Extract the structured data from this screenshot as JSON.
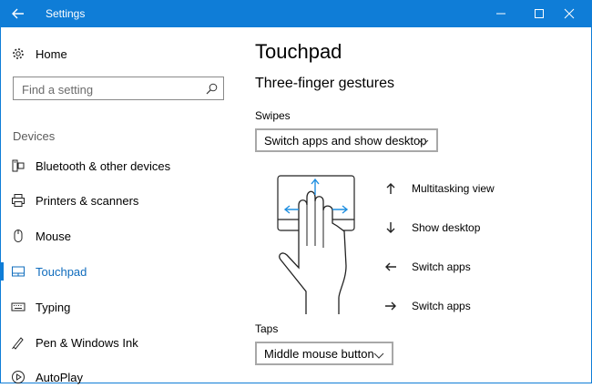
{
  "window": {
    "title": "Settings",
    "accent": "#0f7dd7"
  },
  "sidebar": {
    "home_label": "Home",
    "search_placeholder": "Find a setting",
    "section_label": "Devices",
    "items": [
      {
        "label": "Bluetooth & other devices",
        "icon": "bluetooth-devices-icon",
        "selected": false
      },
      {
        "label": "Printers & scanners",
        "icon": "printer-icon",
        "selected": false
      },
      {
        "label": "Mouse",
        "icon": "mouse-icon",
        "selected": false
      },
      {
        "label": "Touchpad",
        "icon": "touchpad-icon",
        "selected": true
      },
      {
        "label": "Typing",
        "icon": "keyboard-icon",
        "selected": false
      },
      {
        "label": "Pen & Windows Ink",
        "icon": "pen-icon",
        "selected": false
      },
      {
        "label": "AutoPlay",
        "icon": "autoplay-icon",
        "selected": false
      }
    ]
  },
  "main": {
    "title": "Touchpad",
    "subtitle": "Three-finger gestures",
    "swipes_label": "Swipes",
    "swipes_value": "Switch apps and show desktop",
    "gestures": [
      {
        "direction": "up",
        "label": "Multitasking view"
      },
      {
        "direction": "down",
        "label": "Show desktop"
      },
      {
        "direction": "left",
        "label": "Switch apps"
      },
      {
        "direction": "right",
        "label": "Switch apps"
      }
    ],
    "taps_label": "Taps",
    "taps_value": "Middle mouse button"
  }
}
